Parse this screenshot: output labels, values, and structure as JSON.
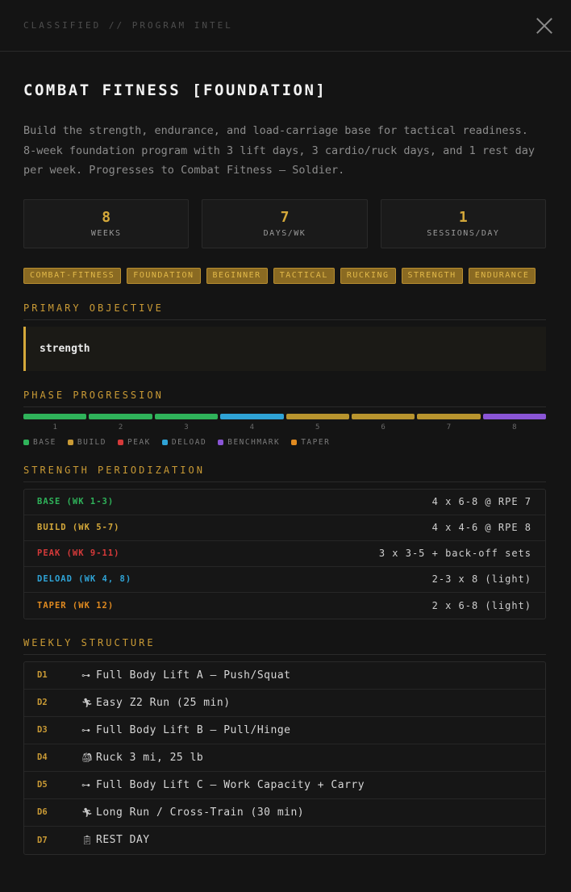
{
  "header": {
    "classified": "CLASSIFIED // PROGRAM INTEL"
  },
  "program": {
    "title": "COMBAT FITNESS [FOUNDATION]",
    "description": "Build the strength, endurance, and load-carriage base for tactical readiness. 8-week foundation program with 3 lift days, 3 cardio/ruck days, and 1 rest day per week. Progresses to Combat Fitness — Soldier."
  },
  "stats": [
    {
      "value": "8",
      "label": "WEEKS"
    },
    {
      "value": "7",
      "label": "DAYS/WK"
    },
    {
      "value": "1",
      "label": "SESSIONS/DAY"
    }
  ],
  "tags": [
    "COMBAT-FITNESS",
    "FOUNDATION",
    "BEGINNER",
    "TACTICAL",
    "RUCKING",
    "STRENGTH",
    "ENDURANCE"
  ],
  "objective": {
    "title": "PRIMARY OBJECTIVE",
    "value": "strength"
  },
  "phases": {
    "title": "PHASE PROGRESSION",
    "weeks": [
      {
        "num": "1",
        "type": "base"
      },
      {
        "num": "2",
        "type": "base"
      },
      {
        "num": "3",
        "type": "base"
      },
      {
        "num": "4",
        "type": "deload"
      },
      {
        "num": "5",
        "type": "build"
      },
      {
        "num": "6",
        "type": "build"
      },
      {
        "num": "7",
        "type": "build"
      },
      {
        "num": "8",
        "type": "benchmark"
      }
    ],
    "legend": [
      {
        "label": "BASE",
        "type": "base"
      },
      {
        "label": "BUILD",
        "type": "build"
      },
      {
        "label": "PEAK",
        "type": "peak"
      },
      {
        "label": "DELOAD",
        "type": "deload"
      },
      {
        "label": "BENCHMARK",
        "type": "benchmark"
      },
      {
        "label": "TAPER",
        "type": "taper"
      }
    ],
    "colors": {
      "base": "#2fb35a",
      "build": "#b8942e",
      "peak": "#d63a3a",
      "deload": "#2fa3d6",
      "benchmark": "#8a55d6",
      "taper": "#e08a20"
    },
    "legend_colors": {
      "base": "#2fb35a",
      "build": "#c99a35",
      "peak": "#d63a3a",
      "deload": "#2fa3d6",
      "benchmark": "#8a55d6",
      "taper": "#e08a20"
    }
  },
  "periodization": {
    "title": "STRENGTH PERIODIZATION",
    "rows": [
      {
        "label": "BASE (WK 1-3)",
        "value": "4 x 6-8 @ RPE 7",
        "color": "#2fb35a"
      },
      {
        "label": "BUILD (WK 5-7)",
        "value": "4 x 4-6 @ RPE 8",
        "color": "#d4a83a"
      },
      {
        "label": "PEAK (WK 9-11)",
        "value": "3 x 3-5 + back-off sets",
        "color": "#d63a3a"
      },
      {
        "label": "DELOAD (WK 4, 8)",
        "value": "2-3 x 8 (light)",
        "color": "#2fa3d6"
      },
      {
        "label": "TAPER (WK 12)",
        "value": "2 x 6-8 (light)",
        "color": "#e08a20"
      }
    ]
  },
  "weekly": {
    "title": "WEEKLY STRUCTURE",
    "days": [
      {
        "day": "D1",
        "icon": "dumbbell-icon",
        "glyph": "⊶",
        "text": "Full Body Lift A — Push/Squat"
      },
      {
        "day": "D2",
        "icon": "runner-icon",
        "glyph": "🏃︎",
        "text": "Easy Z2 Run (25 min)"
      },
      {
        "day": "D3",
        "icon": "dumbbell-icon",
        "glyph": "⊶",
        "text": "Full Body Lift B — Pull/Hinge"
      },
      {
        "day": "D4",
        "icon": "backpack-icon",
        "glyph": "🎒︎",
        "text": "Ruck 3 mi, 25 lb"
      },
      {
        "day": "D5",
        "icon": "dumbbell-icon",
        "glyph": "⊶",
        "text": "Full Body Lift C — Work Capacity + Carry"
      },
      {
        "day": "D6",
        "icon": "runner-icon",
        "glyph": "🏃︎",
        "text": "Long Run / Cross-Train (30 min)"
      },
      {
        "day": "D7",
        "icon": "clipboard-icon",
        "glyph": "📋︎",
        "text": "REST DAY"
      }
    ]
  }
}
